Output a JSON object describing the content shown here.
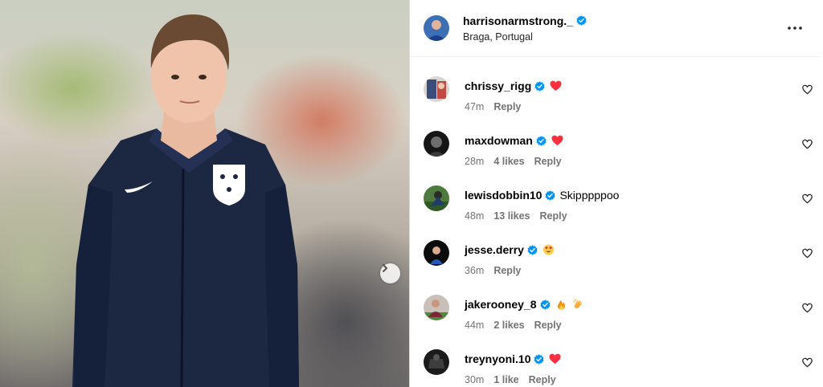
{
  "post": {
    "author": "harrisonarmstrong._",
    "location": "Braga, Portugal"
  },
  "colors": {
    "verified": "#0095f6",
    "heart_emoji": "#ff3040",
    "secondary_text": "#737373",
    "jacket": "#1c2742"
  },
  "icons": {
    "verified": "verified-badge-icon",
    "more": "more-options-icon",
    "like": "heart-outline-icon",
    "next": "chevron-right-icon"
  },
  "comments": [
    {
      "username": "chrissy_rigg",
      "text": "",
      "emoji": [
        "red-heart"
      ],
      "time": "47m",
      "likes": "",
      "reply": "Reply"
    },
    {
      "username": "maxdowman",
      "text": "",
      "emoji": [
        "red-heart"
      ],
      "time": "28m",
      "likes": "4 likes",
      "reply": "Reply"
    },
    {
      "username": "lewisdobbin10",
      "text": "Skipppppoo",
      "emoji": [],
      "time": "48m",
      "likes": "13 likes",
      "reply": "Reply"
    },
    {
      "username": "jesse.derry",
      "text": "",
      "emoji": [
        "heart-eyes"
      ],
      "time": "36m",
      "likes": "",
      "reply": "Reply"
    },
    {
      "username": "jakerooney_8",
      "text": "",
      "emoji": [
        "fire",
        "clapping-hands"
      ],
      "time": "44m",
      "likes": "2 likes",
      "reply": "Reply"
    },
    {
      "username": "treynyoni.10",
      "text": "",
      "emoji": [
        "red-heart"
      ],
      "time": "30m",
      "likes": "1 like",
      "reply": "Reply"
    }
  ]
}
